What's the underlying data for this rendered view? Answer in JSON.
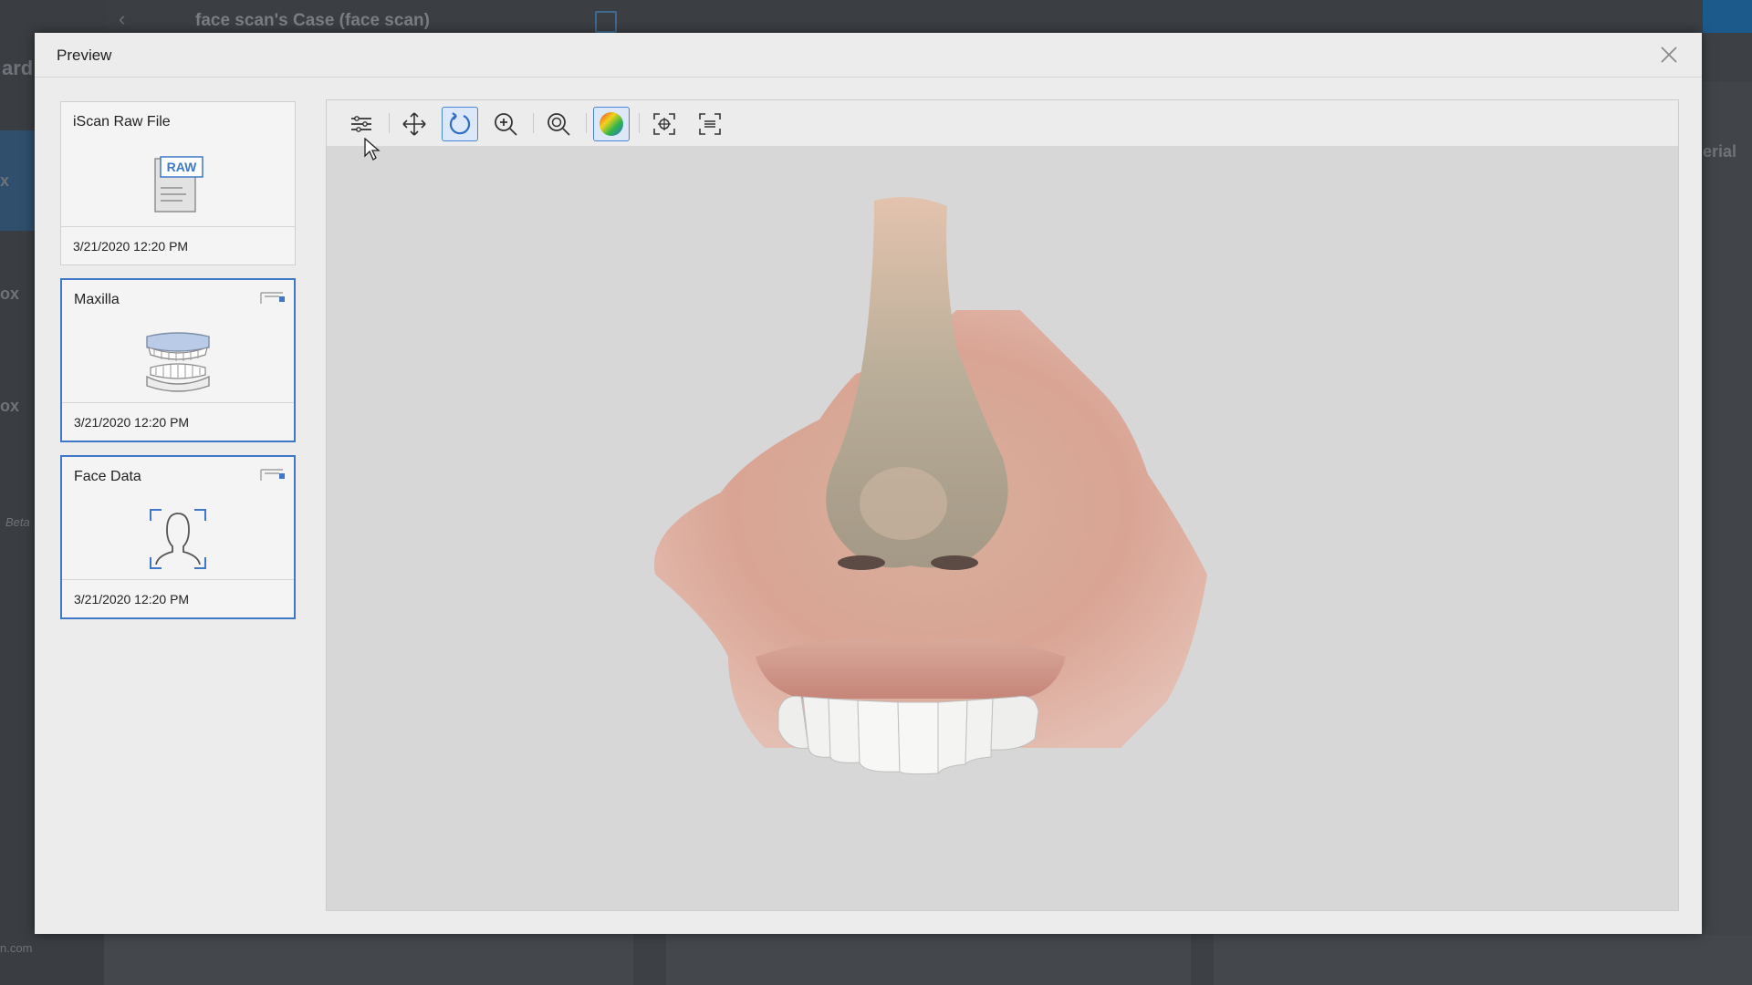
{
  "background": {
    "case_title": "face scan's Case (face scan)",
    "fragments": [
      "ard",
      "x",
      "ox",
      "ox",
      "Beta",
      "erial",
      "n.com"
    ]
  },
  "modal": {
    "title": "Preview"
  },
  "cards": [
    {
      "title": "iScan Raw File",
      "date": "3/21/2020 12:20 PM",
      "thumb_icon": "raw-file-icon",
      "thumb_text": "RAW"
    },
    {
      "title": "Maxilla",
      "date": "3/21/2020 12:20 PM",
      "thumb_icon": "jaw-icon"
    },
    {
      "title": "Face Data",
      "date": "3/21/2020 12:20 PM",
      "thumb_icon": "face-scan-icon"
    }
  ],
  "toolbar": {
    "tools": [
      {
        "name": "settings-icon",
        "active": false
      },
      {
        "name": "pan-icon",
        "active": false
      },
      {
        "name": "rotate-icon",
        "active": true
      },
      {
        "name": "zoom-in-icon",
        "active": false
      },
      {
        "name": "zoom-fit-icon",
        "active": false
      },
      {
        "name": "color-map-icon",
        "active": true
      },
      {
        "name": "focus-icon",
        "active": false
      },
      {
        "name": "fit-view-icon",
        "active": false
      }
    ]
  },
  "colors": {
    "accent": "#3f78c6",
    "viewer_bg": "#d7d7d7",
    "modal_bg": "#ececec"
  }
}
